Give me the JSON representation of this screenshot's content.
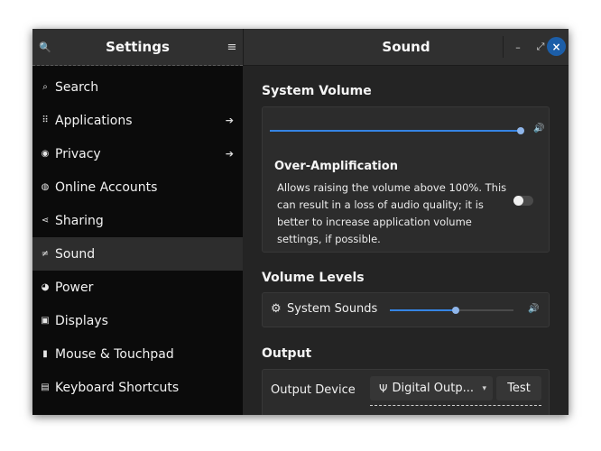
{
  "header": {
    "sidebar_title": "Settings",
    "page_title": "Sound",
    "search_icon": "🔍",
    "menu_icon": "≡",
    "minimize_icon": "–",
    "restore_icon": "⤢",
    "close_icon": "×"
  },
  "sidebar": {
    "items": [
      {
        "label": "Search",
        "icon": "⌕",
        "arrow": ""
      },
      {
        "label": "Applications",
        "icon": "⠿",
        "arrow": "➔"
      },
      {
        "label": "Privacy",
        "icon": "◉",
        "arrow": "➔"
      },
      {
        "label": "Online Accounts",
        "icon": "◍",
        "arrow": ""
      },
      {
        "label": "Sharing",
        "icon": "⋖",
        "arrow": ""
      },
      {
        "label": "Sound",
        "icon": "≠",
        "arrow": ""
      },
      {
        "label": "Power",
        "icon": "◕",
        "arrow": ""
      },
      {
        "label": "Displays",
        "icon": "▣",
        "arrow": ""
      },
      {
        "label": "Mouse & Touchpad",
        "icon": "▮",
        "arrow": ""
      },
      {
        "label": "Keyboard Shortcuts",
        "icon": "▤",
        "arrow": ""
      }
    ],
    "active_index": 5
  },
  "content": {
    "system_volume": {
      "title": "System Volume",
      "level": 1.0,
      "speaker_icon": "🔊",
      "over_amp_title": "Over-Amplification",
      "over_amp_desc": "Allows raising the volume above 100%. This can result in a loss of audio quality; it is better to increase application volume settings, if possible.",
      "over_amp_enabled": false
    },
    "volume_levels": {
      "title": "Volume Levels",
      "system_sounds_label": "System Sounds",
      "gear_icon": "⚙",
      "level": 0.53,
      "speaker_icon": "🔊"
    },
    "output": {
      "title": "Output",
      "device_label": "Output Device",
      "device_value": "Digital Outp...",
      "device_icon": "Ψ",
      "chevron_icon": "▾",
      "test_label": "Test"
    }
  },
  "colors": {
    "accent": "#3584e4",
    "sidebar_bg": "#0b0b0b",
    "content_bg": "#242424",
    "close_button": "#1c5ea8"
  }
}
